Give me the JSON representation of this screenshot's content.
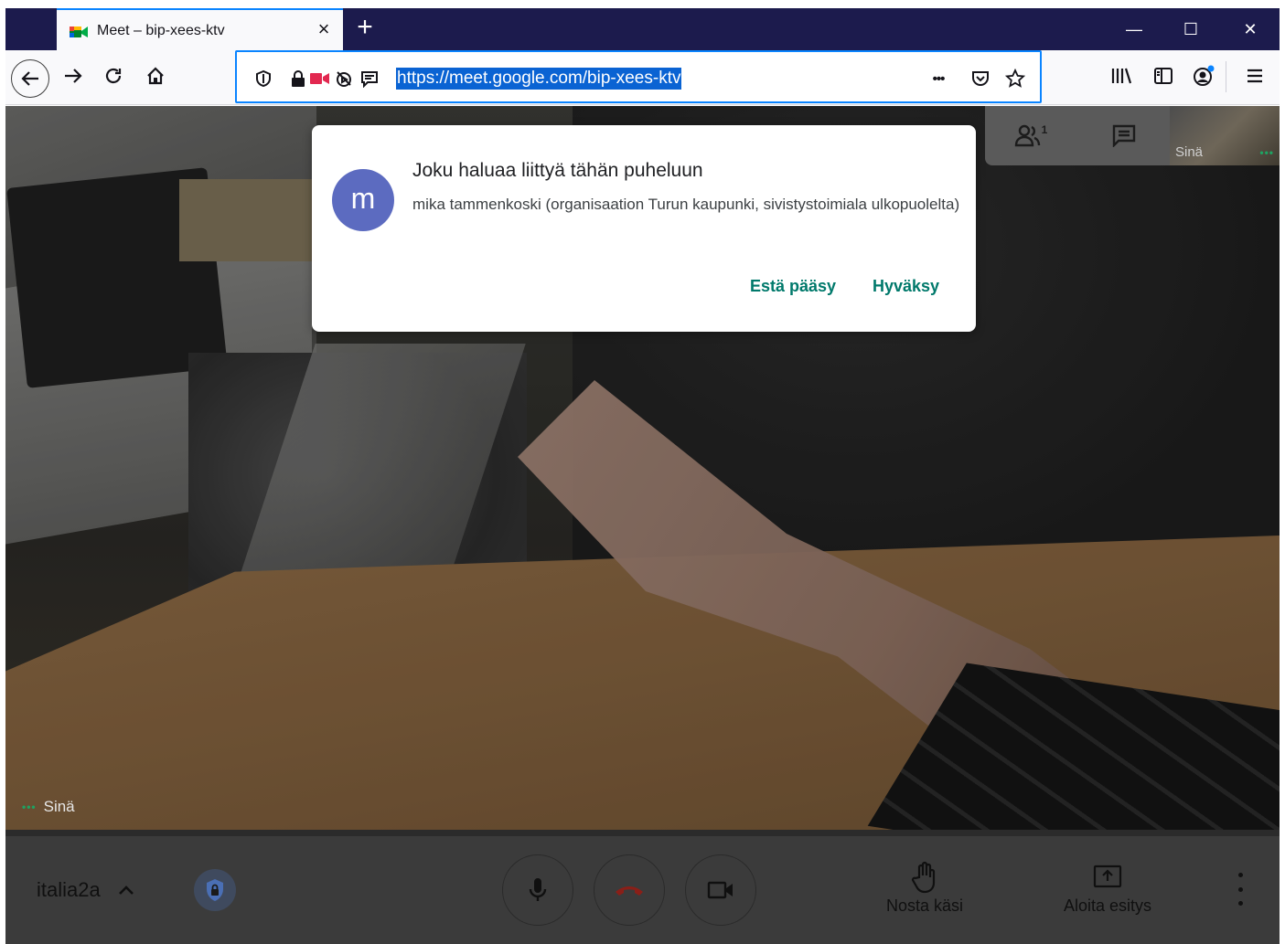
{
  "browser": {
    "tab_title": "Meet – bip-xees-ktv",
    "new_tab": "+",
    "url": "https://meet.google.com/bip-xees-ktv",
    "url_more": "•••"
  },
  "dialog": {
    "avatar_letter": "m",
    "title": "Joku haluaa liittyä tähän puheluun",
    "message": "mika tammenkoski (organisaation Turun kaupunki, sivistystoimiala ulkopuolelta)",
    "deny_label": "Estä pääsy",
    "accept_label": "Hyväksy"
  },
  "top_controls": {
    "participants_count": "1",
    "self_thumb_label": "Sinä"
  },
  "video": {
    "self_label": "Sinä",
    "dots": "•••"
  },
  "bottom_bar": {
    "meeting_name": "italia2a",
    "raise_hand_label": "Nosta käsi",
    "present_label": "Aloita esitys"
  },
  "colors": {
    "accent": "#00796b",
    "avatar": "#5c6bc0",
    "browser_accent": "#0a84ff",
    "hangup": "#d93025"
  }
}
